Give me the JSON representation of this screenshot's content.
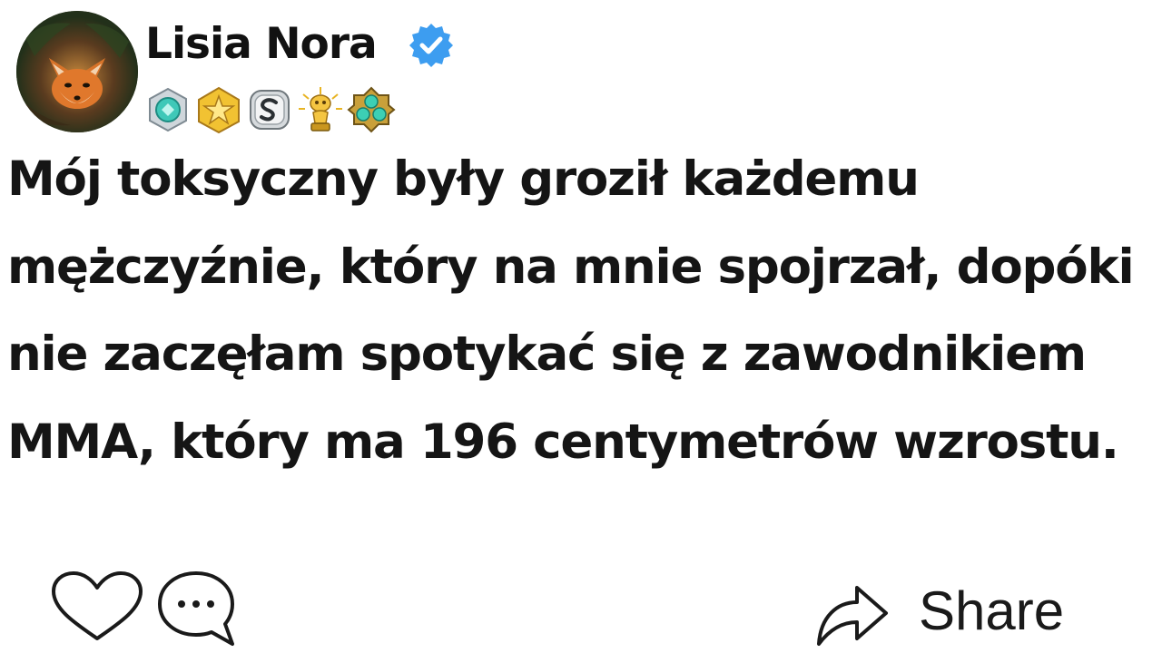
{
  "post": {
    "author": {
      "name": "Lisia Nora",
      "avatar": "fox-in-burrow-avatar",
      "verified_icon": "verified-check-icon",
      "verified_color": "#3d9df0"
    },
    "badges": [
      {
        "icon": "silver-gem-badge-icon"
      },
      {
        "icon": "gold-star-badge-icon"
      },
      {
        "icon": "silver-s-badge-icon"
      },
      {
        "icon": "golden-trophy-figure-badge-icon"
      },
      {
        "icon": "gold-clover-gem-badge-icon"
      }
    ],
    "text": "Mój toksyczny były groził każdemu mężczyźnie, który na mnie spojrzał, dopóki nie zaczęłam spotykać się z zawodnikiem MMA, który ma 196 centymetrów wzrostu."
  },
  "actions": {
    "like_icon": "heart-outline-icon",
    "comment_icon": "speech-bubble-icon",
    "share_icon": "share-arrow-icon",
    "share_label": "Share"
  },
  "colors": {
    "text": "#151515",
    "background": "#ffffff"
  }
}
